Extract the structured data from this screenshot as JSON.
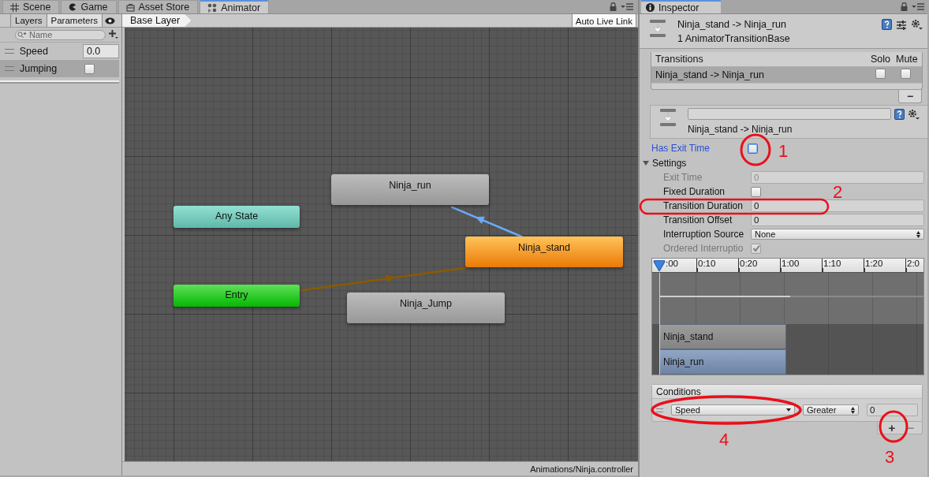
{
  "editor_tabs": [
    {
      "label": "Scene",
      "kind": "scene",
      "selected": false
    },
    {
      "label": "Game",
      "kind": "game",
      "selected": false
    },
    {
      "label": "Asset Store",
      "kind": "store",
      "selected": false
    },
    {
      "label": "Animator",
      "kind": "animator",
      "selected": true
    }
  ],
  "parameters_panel": {
    "tabs": [
      {
        "label": "Layers",
        "selected": false
      },
      {
        "label": "Parameters",
        "selected": true
      }
    ],
    "search": {
      "placeholder": "Name"
    },
    "parameters": [
      {
        "name": "Speed",
        "kind": "float",
        "value": "0.0",
        "selected": false
      },
      {
        "name": "Jumping",
        "kind": "bool",
        "checked": false,
        "selected": true
      }
    ]
  },
  "animator": {
    "breadcrumb": "Base Layer",
    "live_link_button": "Auto Live Link",
    "states": [
      {
        "name": "Ninja_run",
        "kind": "state"
      },
      {
        "name": "Any State",
        "kind": "any"
      },
      {
        "name": "Ninja_stand",
        "kind": "default"
      },
      {
        "name": "Entry",
        "kind": "entry"
      },
      {
        "name": "Ninja_Jump",
        "kind": "state"
      }
    ],
    "transitions": [
      {
        "selected": true
      },
      {
        "selected": false
      }
    ],
    "status_bar": "Animations/Ninja.controller"
  },
  "inspector": {
    "tab": "Inspector",
    "title": "Ninja_stand -> Ninja_run",
    "subtitle": "1 AnimatorTransitionBase",
    "transitions_list": {
      "columns": [
        "Transitions",
        "Solo",
        "Mute"
      ],
      "rows": [
        {
          "name": "Ninja_stand -> Ninja_run",
          "solo": false,
          "mute": false,
          "selected": true
        }
      ],
      "remove_button": "−"
    },
    "transition_name": "Ninja_stand -> Ninja_run",
    "has_exit_time": {
      "label": "Has Exit Time",
      "checked": false,
      "focused": true
    },
    "settings": {
      "label": "Settings",
      "expanded": true,
      "rows": [
        {
          "label": "Exit Time",
          "kind": "number",
          "value": "0",
          "disabled": true
        },
        {
          "label": "Fixed Duration",
          "kind": "checkbox",
          "checked": false,
          "disabled": false
        },
        {
          "label": "Transition Duration",
          "kind": "number",
          "value": "0",
          "disabled": false
        },
        {
          "label": "Transition Offset",
          "kind": "number",
          "value": "0",
          "disabled": false
        },
        {
          "label": "Interruption Source",
          "kind": "dropdown",
          "value": "None",
          "disabled": false
        },
        {
          "label": "Ordered Interruptio",
          "kind": "checkbox",
          "checked": true,
          "disabled": true
        }
      ]
    },
    "timeline": {
      "ticks": [
        ":00",
        "0:10",
        "0:20",
        "1:00",
        "1:10",
        "1:20",
        "2:0"
      ],
      "clips": [
        {
          "name": "Ninja_stand",
          "kind": "source"
        },
        {
          "name": "Ninja_run",
          "kind": "destination"
        }
      ]
    },
    "conditions": {
      "title": "Conditions",
      "rows": [
        {
          "parameter": "Speed",
          "mode": "Greater",
          "value": "0"
        }
      ],
      "add_button": "+",
      "remove_button": "−"
    }
  },
  "annotations": [
    {
      "label": "1",
      "kind": "circle"
    },
    {
      "label": "2",
      "kind": "ellipse"
    },
    {
      "label": "3",
      "kind": "circle"
    },
    {
      "label": "4",
      "kind": "ellipse"
    }
  ]
}
